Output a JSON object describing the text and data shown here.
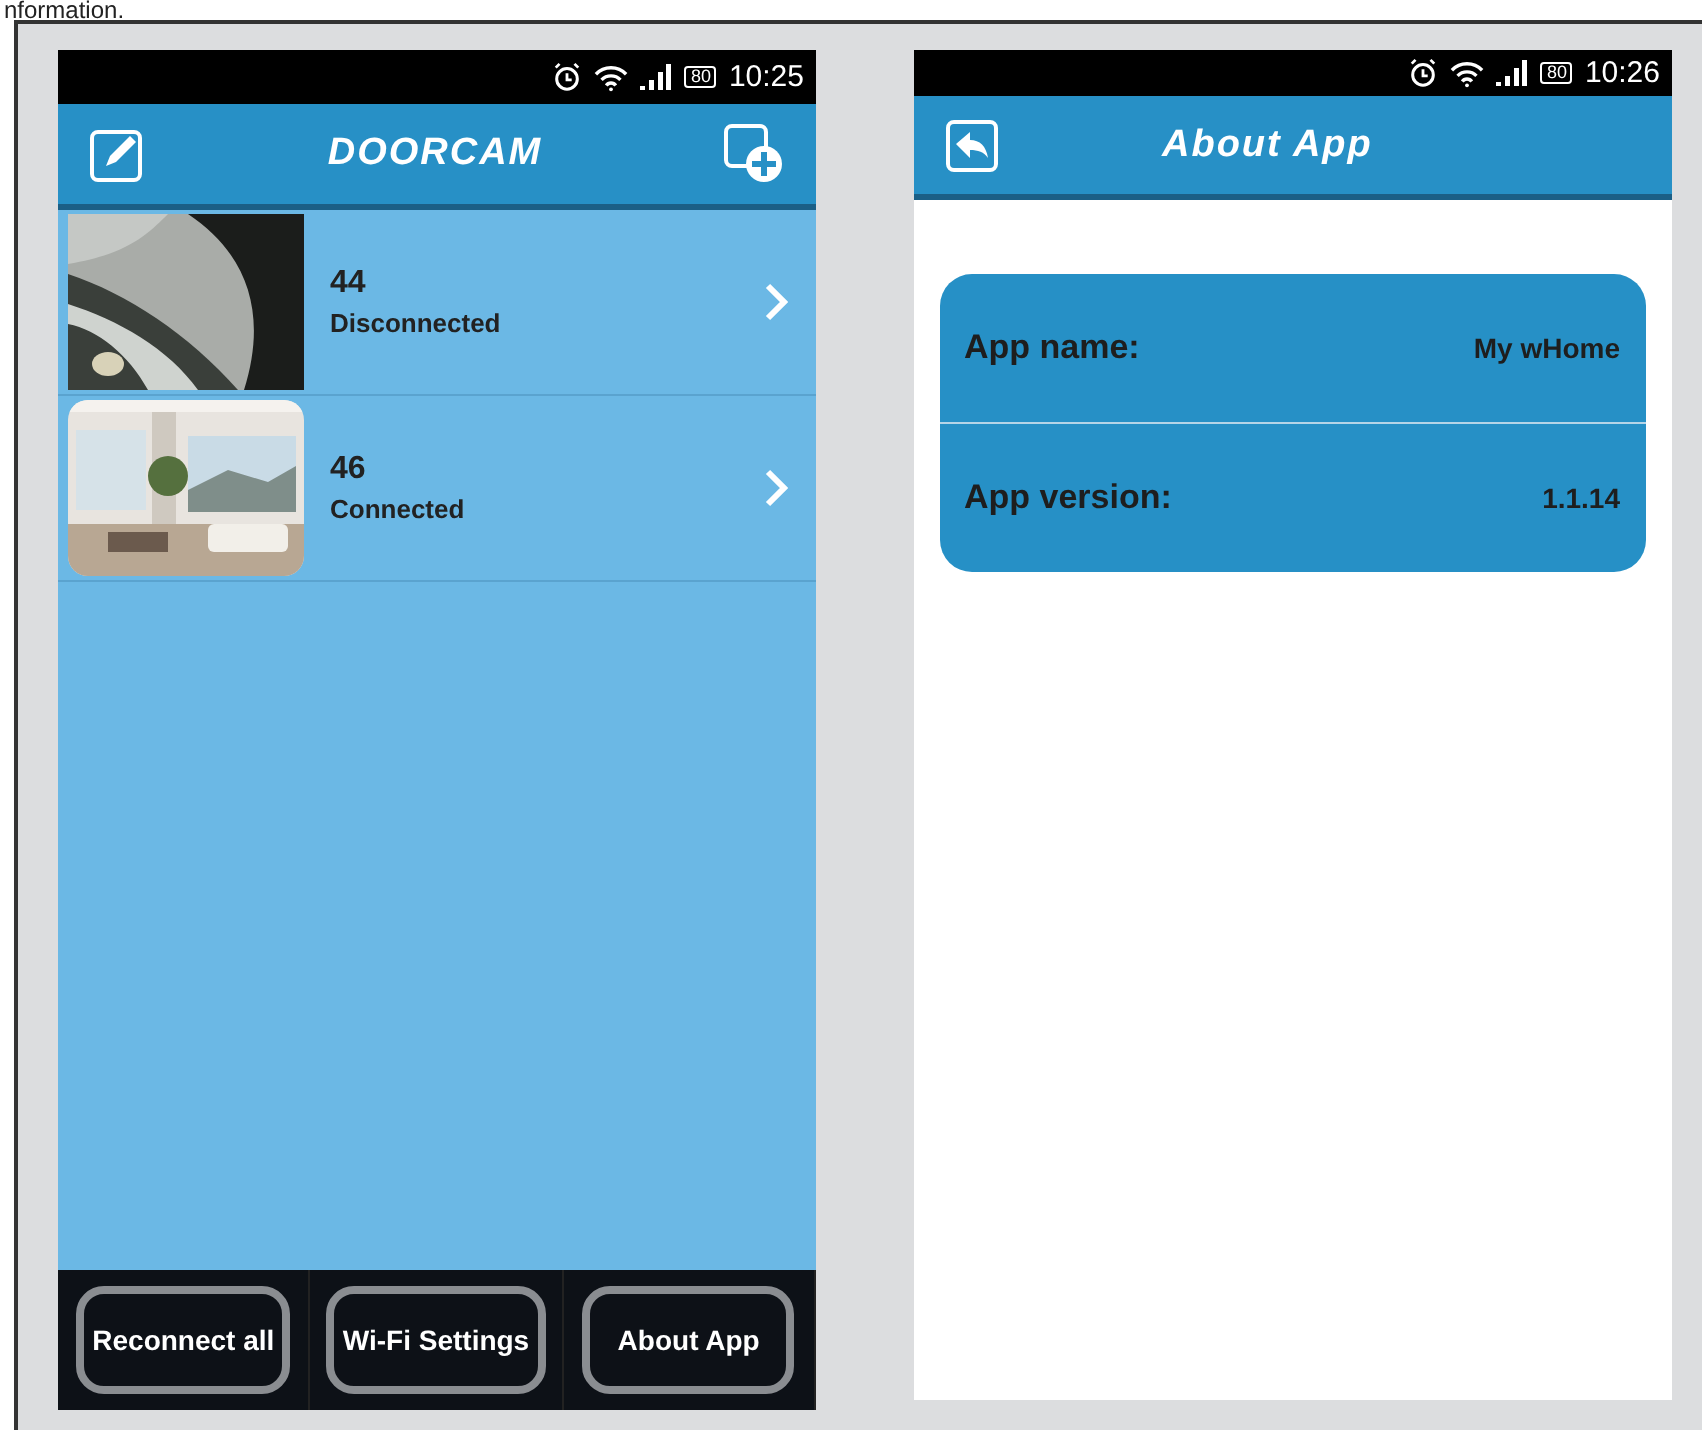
{
  "caption": "nformation.",
  "screens": [
    {
      "status_bar": {
        "battery": "80",
        "time": "10:25"
      },
      "header": {
        "title": "DOORCAM"
      },
      "cameras": [
        {
          "name": "44",
          "status": "Disconnected",
          "kind": "closeup"
        },
        {
          "name": "46",
          "status": "Connected",
          "kind": "room"
        }
      ],
      "buttons": [
        "Reconnect all",
        "Wi-Fi Settings",
        "About App"
      ]
    },
    {
      "status_bar": {
        "battery": "80",
        "time": "10:26"
      },
      "header": {
        "title": "About App"
      },
      "info": [
        {
          "label": "App name:",
          "value": "My wHome"
        },
        {
          "label": "App version:",
          "value": "1.1.14"
        }
      ]
    }
  ]
}
